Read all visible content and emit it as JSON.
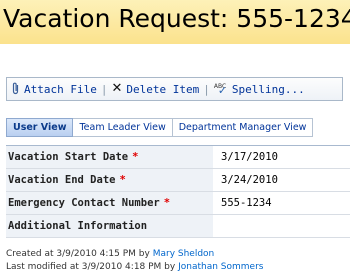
{
  "header": {
    "title": "Vacation Request: 555-1234"
  },
  "toolbar": {
    "attach_label": "Attach File",
    "delete_label": "Delete Item",
    "spelling_label": "Spelling...",
    "separator": "|"
  },
  "tabs": [
    {
      "label": "User View",
      "active": true
    },
    {
      "label": "Team Leader View",
      "active": false
    },
    {
      "label": "Department Manager View",
      "active": false
    }
  ],
  "form": {
    "required_marker": "*",
    "fields": [
      {
        "label": "Vacation Start Date",
        "required": true,
        "value": "3/17/2010"
      },
      {
        "label": "Vacation End Date",
        "required": true,
        "value": "3/24/2010"
      },
      {
        "label": "Emergency Contact Number",
        "required": true,
        "value": "555-1234"
      },
      {
        "label": "Additional Information",
        "required": false,
        "value": ""
      }
    ]
  },
  "footer": {
    "created_prefix": "Created at 3/9/2010 4:15 PM  by",
    "created_by": "Mary Sheldon",
    "modified_prefix": "Last modified at 3/9/2010 4:18 PM  by",
    "modified_by": "Jonathan Sommers"
  },
  "colors": {
    "title_bar": "#fbe28d",
    "link": "#0066cc",
    "required": "#e00000",
    "label_bg": "#eef2f7"
  }
}
